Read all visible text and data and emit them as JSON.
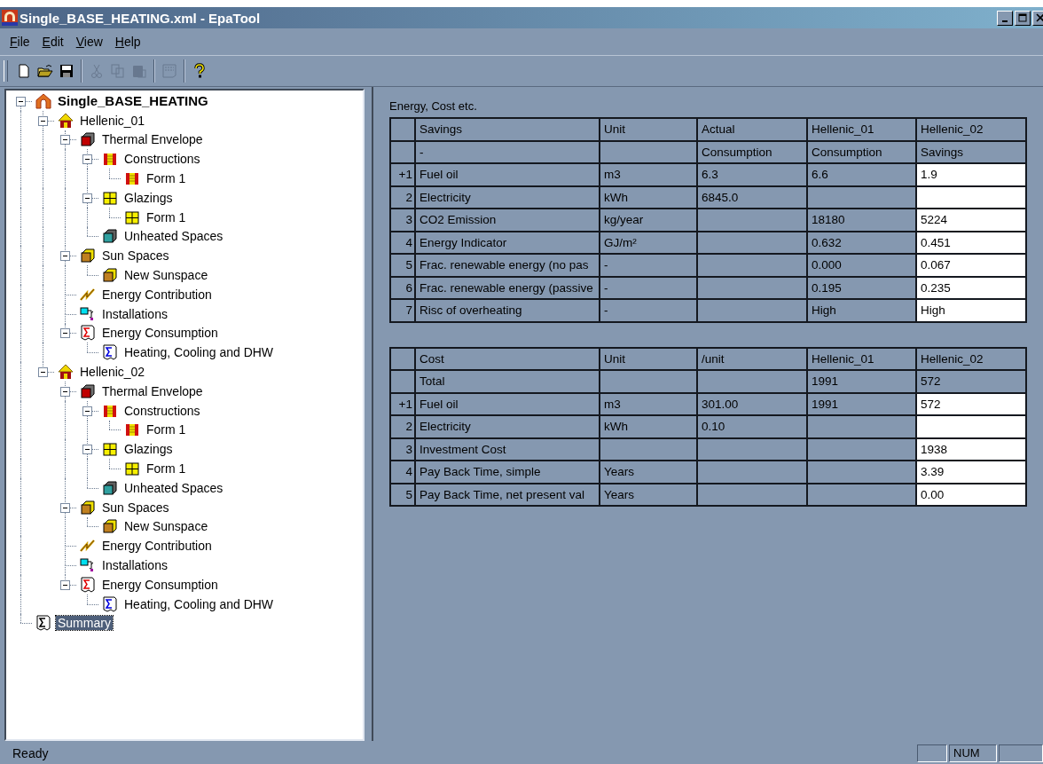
{
  "window": {
    "title": "Single_BASE_HEATING.xml - EpaTool"
  },
  "menu": [
    "File",
    "Edit",
    "View",
    "Help"
  ],
  "toolbar": [
    {
      "kind": "new",
      "disabled": false
    },
    {
      "kind": "open",
      "disabled": false
    },
    {
      "kind": "save",
      "disabled": false
    },
    {
      "kind": "separator"
    },
    {
      "kind": "cut",
      "disabled": true
    },
    {
      "kind": "copy",
      "disabled": true
    },
    {
      "kind": "paste",
      "disabled": true
    },
    {
      "kind": "separator"
    },
    {
      "kind": "preview",
      "disabled": true
    },
    {
      "kind": "separator"
    },
    {
      "kind": "help",
      "disabled": false
    }
  ],
  "tree": [
    {
      "label": "Single_BASE_HEATING",
      "kind": "project",
      "selected": false,
      "expanded": true,
      "children": [
        {
          "label": "Hellenic_01",
          "kind": "house",
          "selected": false,
          "expanded": true,
          "children": [
            {
              "label": "Thermal Envelope",
              "kind": "envelope",
              "selected": false,
              "expanded": true,
              "children": [
                {
                  "label": "Constructions",
                  "kind": "construction",
                  "selected": false,
                  "expanded": true,
                  "children": [
                    {
                      "label": "Form 1",
                      "kind": "construction",
                      "selected": false
                    }
                  ]
                },
                {
                  "label": "Glazings",
                  "kind": "glazing",
                  "selected": false,
                  "expanded": true,
                  "children": [
                    {
                      "label": "Form 1",
                      "kind": "glazing",
                      "selected": false
                    }
                  ]
                },
                {
                  "label": "Unheated Spaces",
                  "kind": "unheated",
                  "selected": false
                }
              ]
            },
            {
              "label": "Sun Spaces",
              "kind": "sunspace",
              "selected": false,
              "expanded": true,
              "children": [
                {
                  "label": "New Sunspace",
                  "kind": "sunspace",
                  "selected": false
                }
              ]
            },
            {
              "label": "Energy Contribution",
              "kind": "energy",
              "selected": false
            },
            {
              "label": "Installations",
              "kind": "installation",
              "selected": false
            },
            {
              "label": "Energy Consumption",
              "kind": "sum-red",
              "selected": false,
              "expanded": true,
              "children": [
                {
                  "label": "Heating, Cooling and DHW",
                  "kind": "sum-blue",
                  "selected": false
                }
              ]
            }
          ]
        },
        {
          "label": "Hellenic_02",
          "kind": "house",
          "selected": false,
          "expanded": true,
          "children": [
            {
              "label": "Thermal Envelope",
              "kind": "envelope",
              "selected": false,
              "expanded": true,
              "children": [
                {
                  "label": "Constructions",
                  "kind": "construction",
                  "selected": false,
                  "expanded": true,
                  "children": [
                    {
                      "label": "Form 1",
                      "kind": "construction",
                      "selected": false
                    }
                  ]
                },
                {
                  "label": "Glazings",
                  "kind": "glazing",
                  "selected": false,
                  "expanded": true,
                  "children": [
                    {
                      "label": "Form 1",
                      "kind": "glazing",
                      "selected": false
                    }
                  ]
                },
                {
                  "label": "Unheated Spaces",
                  "kind": "unheated",
                  "selected": false
                }
              ]
            },
            {
              "label": "Sun Spaces",
              "kind": "sunspace",
              "selected": false,
              "expanded": true,
              "children": [
                {
                  "label": "New Sunspace",
                  "kind": "sunspace",
                  "selected": false
                }
              ]
            },
            {
              "label": "Energy Contribution",
              "kind": "energy",
              "selected": false
            },
            {
              "label": "Installations",
              "kind": "installation",
              "selected": false
            },
            {
              "label": "Energy Consumption",
              "kind": "sum-red",
              "selected": false,
              "expanded": true,
              "children": [
                {
                  "label": "Heating, Cooling and DHW",
                  "kind": "sum-blue",
                  "selected": false
                }
              ]
            }
          ]
        }
      ]
    },
    {
      "label": "Summary",
      "kind": "sum-black",
      "selected": true
    }
  ],
  "content": {
    "caption": "Energy, Cost etc.",
    "tables": [
      {
        "columns": [
          "Savings",
          "Unit",
          "Actual",
          "Hellenic_01",
          "Hellenic_02"
        ],
        "rows": [
          {
            "kind": "subheader",
            "cells": [
              "-",
              null,
              "Consumption",
              "Consumption",
              "Savings"
            ]
          },
          {
            "kind": "data",
            "header": "+1",
            "cells": [
              "Fuel oil",
              "m3",
              "6.3",
              "6.6",
              "1.9"
            ]
          },
          {
            "kind": "data",
            "header": "2",
            "cells": [
              "Electricity",
              "kWh",
              "6845.0",
              null,
              null
            ]
          },
          {
            "kind": "data",
            "header": "3",
            "cells": [
              "CO2 Emission",
              "kg/year",
              null,
              "18180",
              "5224"
            ]
          },
          {
            "kind": "data",
            "header": "4",
            "cells": [
              "Energy Indicator",
              "GJ/m²",
              null,
              "0.632",
              "0.451"
            ]
          },
          {
            "kind": "data",
            "header": "5",
            "cells": [
              "Frac. renewable energy (no pas",
              "-",
              null,
              "0.000",
              "0.067"
            ]
          },
          {
            "kind": "data",
            "header": "6",
            "cells": [
              "Frac. renewable energy (passive",
              "-",
              null,
              "0.195",
              "0.235"
            ]
          },
          {
            "kind": "data",
            "header": "7",
            "cells": [
              "Risc of overheating",
              "-",
              null,
              "High",
              "High"
            ]
          }
        ]
      },
      {
        "columns": [
          "Cost",
          "Unit",
          "/unit",
          "Hellenic_01",
          "Hellenic_02"
        ],
        "rows": [
          {
            "kind": "subheader",
            "cells": [
              "Total",
              null,
              null,
              "1991",
              "572"
            ]
          },
          {
            "kind": "data",
            "header": "+1",
            "cells": [
              "Fuel oil",
              "m3",
              "301.00",
              "1991",
              "572"
            ]
          },
          {
            "kind": "data",
            "header": "2",
            "cells": [
              "Electricity",
              "kWh",
              "0.10",
              null,
              null
            ]
          },
          {
            "kind": "data",
            "header": "3",
            "cells": [
              "Investment Cost",
              null,
              null,
              null,
              "1938"
            ]
          },
          {
            "kind": "data",
            "header": "4",
            "cells": [
              "Pay Back Time, simple",
              "Years",
              null,
              null,
              "3.39"
            ]
          },
          {
            "kind": "data",
            "header": "5",
            "cells": [
              "Pay Back Time, net present val",
              "Years",
              null,
              null,
              "0.00"
            ]
          }
        ]
      }
    ]
  },
  "status_bar": {
    "text": "Ready",
    "panes": [
      {
        "kind": "empty"
      },
      {
        "kind": "text",
        "text": "NUM"
      },
      {
        "kind": "empty"
      }
    ]
  }
}
